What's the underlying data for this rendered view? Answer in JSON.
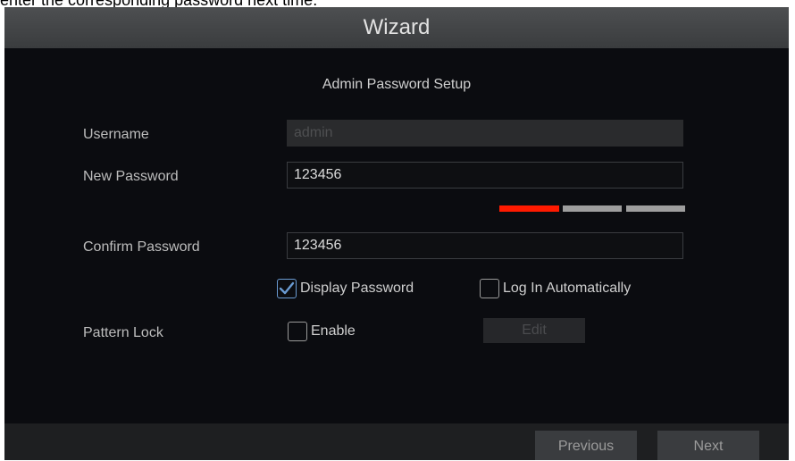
{
  "caption": "enter the corresponding password next time.",
  "window": {
    "title": "Wizard"
  },
  "section": {
    "title": "Admin Password Setup"
  },
  "form": {
    "username_label": "Username",
    "username_value": "admin",
    "new_password_label": "New Password",
    "new_password_value": "123456",
    "confirm_password_label": "Confirm Password",
    "confirm_password_value": "123456",
    "password_strength_level": "1 of 3",
    "display_password_label": "Display Password",
    "display_password_checked": true,
    "log_in_automatically_label": "Log In Automatically",
    "log_in_automatically_checked": false,
    "pattern_lock_label": "Pattern Lock",
    "enable_label": "Enable",
    "enable_checked": false,
    "edit_label": "Edit"
  },
  "footer": {
    "previous_label": "Previous",
    "next_label": "Next"
  },
  "colors": {
    "background": "#0b0c10",
    "titlebar": "#45474a",
    "strength_weak": "#ff1a00",
    "strength_empty": "#9e9e9e",
    "check_mark": "#6a9bd2"
  }
}
